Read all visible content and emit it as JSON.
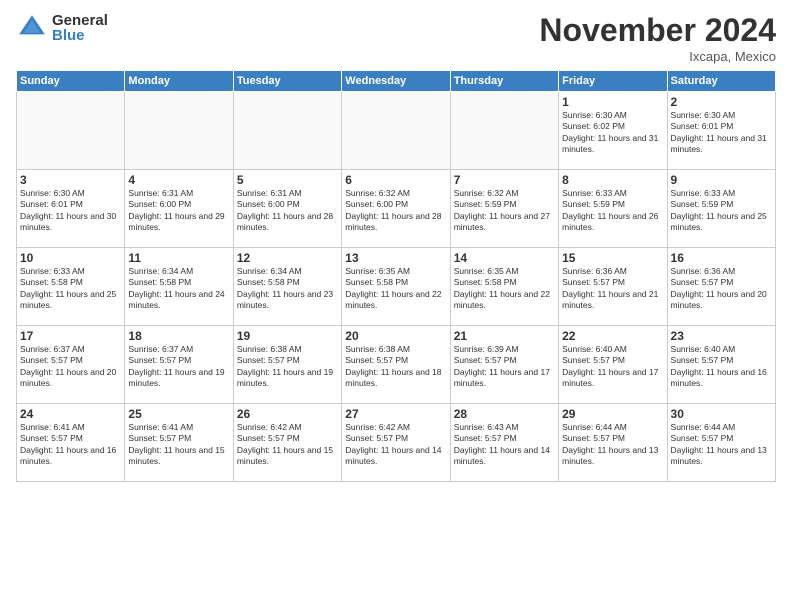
{
  "logo": {
    "general": "General",
    "blue": "Blue"
  },
  "header": {
    "month_title": "November 2024",
    "location": "Ixcapa, Mexico"
  },
  "weekdays": [
    "Sunday",
    "Monday",
    "Tuesday",
    "Wednesday",
    "Thursday",
    "Friday",
    "Saturday"
  ],
  "weeks": [
    [
      {
        "day": "",
        "info": ""
      },
      {
        "day": "",
        "info": ""
      },
      {
        "day": "",
        "info": ""
      },
      {
        "day": "",
        "info": ""
      },
      {
        "day": "",
        "info": ""
      },
      {
        "day": "1",
        "info": "Sunrise: 6:30 AM\nSunset: 6:02 PM\nDaylight: 11 hours and 31 minutes."
      },
      {
        "day": "2",
        "info": "Sunrise: 6:30 AM\nSunset: 6:01 PM\nDaylight: 11 hours and 31 minutes."
      }
    ],
    [
      {
        "day": "3",
        "info": "Sunrise: 6:30 AM\nSunset: 6:01 PM\nDaylight: 11 hours and 30 minutes."
      },
      {
        "day": "4",
        "info": "Sunrise: 6:31 AM\nSunset: 6:00 PM\nDaylight: 11 hours and 29 minutes."
      },
      {
        "day": "5",
        "info": "Sunrise: 6:31 AM\nSunset: 6:00 PM\nDaylight: 11 hours and 28 minutes."
      },
      {
        "day": "6",
        "info": "Sunrise: 6:32 AM\nSunset: 6:00 PM\nDaylight: 11 hours and 28 minutes."
      },
      {
        "day": "7",
        "info": "Sunrise: 6:32 AM\nSunset: 5:59 PM\nDaylight: 11 hours and 27 minutes."
      },
      {
        "day": "8",
        "info": "Sunrise: 6:33 AM\nSunset: 5:59 PM\nDaylight: 11 hours and 26 minutes."
      },
      {
        "day": "9",
        "info": "Sunrise: 6:33 AM\nSunset: 5:59 PM\nDaylight: 11 hours and 25 minutes."
      }
    ],
    [
      {
        "day": "10",
        "info": "Sunrise: 6:33 AM\nSunset: 5:58 PM\nDaylight: 11 hours and 25 minutes."
      },
      {
        "day": "11",
        "info": "Sunrise: 6:34 AM\nSunset: 5:58 PM\nDaylight: 11 hours and 24 minutes."
      },
      {
        "day": "12",
        "info": "Sunrise: 6:34 AM\nSunset: 5:58 PM\nDaylight: 11 hours and 23 minutes."
      },
      {
        "day": "13",
        "info": "Sunrise: 6:35 AM\nSunset: 5:58 PM\nDaylight: 11 hours and 22 minutes."
      },
      {
        "day": "14",
        "info": "Sunrise: 6:35 AM\nSunset: 5:58 PM\nDaylight: 11 hours and 22 minutes."
      },
      {
        "day": "15",
        "info": "Sunrise: 6:36 AM\nSunset: 5:57 PM\nDaylight: 11 hours and 21 minutes."
      },
      {
        "day": "16",
        "info": "Sunrise: 6:36 AM\nSunset: 5:57 PM\nDaylight: 11 hours and 20 minutes."
      }
    ],
    [
      {
        "day": "17",
        "info": "Sunrise: 6:37 AM\nSunset: 5:57 PM\nDaylight: 11 hours and 20 minutes."
      },
      {
        "day": "18",
        "info": "Sunrise: 6:37 AM\nSunset: 5:57 PM\nDaylight: 11 hours and 19 minutes."
      },
      {
        "day": "19",
        "info": "Sunrise: 6:38 AM\nSunset: 5:57 PM\nDaylight: 11 hours and 19 minutes."
      },
      {
        "day": "20",
        "info": "Sunrise: 6:38 AM\nSunset: 5:57 PM\nDaylight: 11 hours and 18 minutes."
      },
      {
        "day": "21",
        "info": "Sunrise: 6:39 AM\nSunset: 5:57 PM\nDaylight: 11 hours and 17 minutes."
      },
      {
        "day": "22",
        "info": "Sunrise: 6:40 AM\nSunset: 5:57 PM\nDaylight: 11 hours and 17 minutes."
      },
      {
        "day": "23",
        "info": "Sunrise: 6:40 AM\nSunset: 5:57 PM\nDaylight: 11 hours and 16 minutes."
      }
    ],
    [
      {
        "day": "24",
        "info": "Sunrise: 6:41 AM\nSunset: 5:57 PM\nDaylight: 11 hours and 16 minutes."
      },
      {
        "day": "25",
        "info": "Sunrise: 6:41 AM\nSunset: 5:57 PM\nDaylight: 11 hours and 15 minutes."
      },
      {
        "day": "26",
        "info": "Sunrise: 6:42 AM\nSunset: 5:57 PM\nDaylight: 11 hours and 15 minutes."
      },
      {
        "day": "27",
        "info": "Sunrise: 6:42 AM\nSunset: 5:57 PM\nDaylight: 11 hours and 14 minutes."
      },
      {
        "day": "28",
        "info": "Sunrise: 6:43 AM\nSunset: 5:57 PM\nDaylight: 11 hours and 14 minutes."
      },
      {
        "day": "29",
        "info": "Sunrise: 6:44 AM\nSunset: 5:57 PM\nDaylight: 11 hours and 13 minutes."
      },
      {
        "day": "30",
        "info": "Sunrise: 6:44 AM\nSunset: 5:57 PM\nDaylight: 11 hours and 13 minutes."
      }
    ]
  ]
}
